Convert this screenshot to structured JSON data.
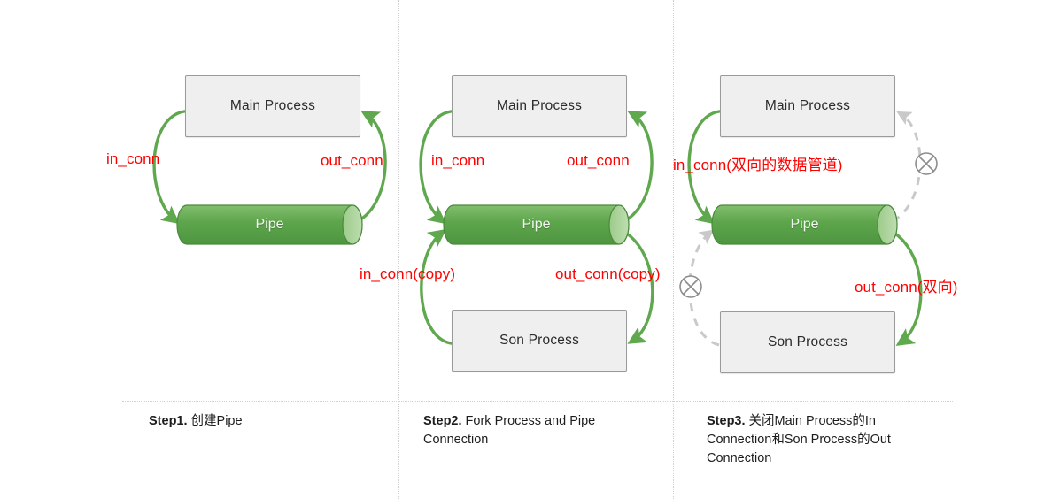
{
  "figure": {
    "title": "Pipe / Fork process connection diagram",
    "accent_green": "#5FA84E",
    "label_red": "#FF0000",
    "box_fill": "#EFEFEF",
    "box_border": "#9A9A9A",
    "divider_color": "#CFCFCF",
    "dashed_gray": "#C9C9C9"
  },
  "panels": [
    {
      "id": "step1",
      "caption_bold": "Step1.",
      "caption_rest": " 创建Pipe",
      "nodes": {
        "main_process": "Main Process",
        "pipe": "Pipe"
      },
      "labels": [
        {
          "name": "in-conn",
          "text": "in_conn"
        },
        {
          "name": "out-conn",
          "text": "out_conn"
        }
      ]
    },
    {
      "id": "step2",
      "caption_bold": "Step2.",
      "caption_rest": " Fork Process and Pipe Connection",
      "nodes": {
        "main_process": "Main Process",
        "pipe": "Pipe",
        "son_process": "Son Process"
      },
      "labels": [
        {
          "name": "in-conn",
          "text": "in_conn"
        },
        {
          "name": "out-conn",
          "text": "out_conn"
        },
        {
          "name": "in-conn-copy",
          "text": "in_conn(copy)"
        },
        {
          "name": "out-conn-copy",
          "text": "out_conn(copy)"
        }
      ]
    },
    {
      "id": "step3",
      "caption_bold": "Step3.",
      "caption_rest": " 关闭Main Process的In Connection和Son Process的Out Connection",
      "nodes": {
        "main_process": "Main Process",
        "pipe": "Pipe",
        "son_process": "Son Process"
      },
      "labels": [
        {
          "name": "in-conn-bidir",
          "text": "in_conn(双向的数据管道)"
        },
        {
          "name": "out-conn-bidir",
          "text": "out_conn(双向)"
        }
      ],
      "closed_markers": 2
    }
  ],
  "text": {
    "main_process": "Main Process",
    "son_process": "Son Process",
    "pipe": "Pipe",
    "p1_in_conn": "in_conn",
    "p1_out_conn": "out_conn",
    "p2_in_conn": "in_conn",
    "p2_out_conn": "out_conn",
    "p2_in_conn_copy": "in_conn(copy)",
    "p2_out_conn_copy": "out_conn(copy)",
    "p3_in_conn": "in_conn(双向的数据管道)",
    "p3_out_conn": "out_conn(双向)",
    "cap1_bold": "Step1.",
    "cap1_rest": " 创建Pipe",
    "cap2_bold": "Step2.",
    "cap2_rest": " Fork Process and Pipe Connection",
    "cap3_bold": "Step3.",
    "cap3_rest": " 关闭Main Process的In Connection和Son Process的Out Connection"
  }
}
